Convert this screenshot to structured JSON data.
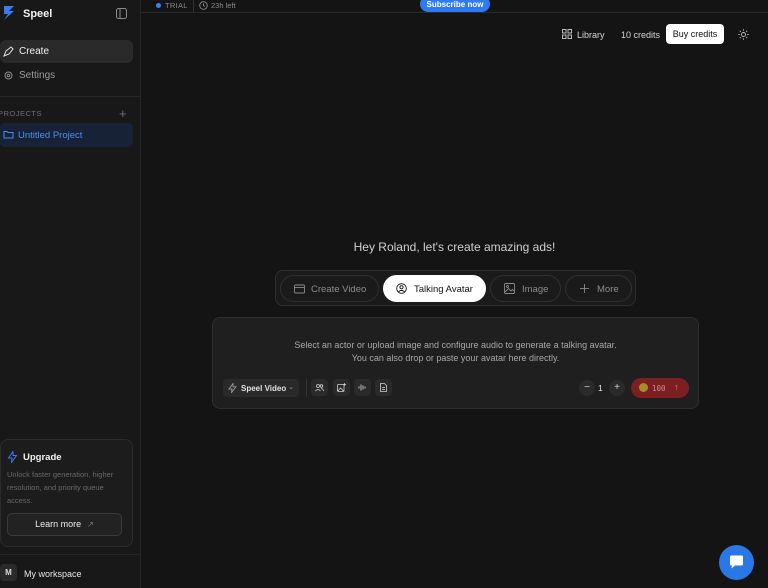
{
  "app": {
    "name": "Speel"
  },
  "sidebar": {
    "nav": [
      {
        "label": "Create",
        "icon": "pen-tool-icon",
        "active": true
      },
      {
        "label": "Settings",
        "icon": "gear-icon",
        "active": false
      }
    ],
    "projects_heading": "PROJECTS",
    "projects": [
      {
        "label": "Untitled Project",
        "icon": "folder-icon"
      }
    ],
    "upgrade": {
      "title": "Upgrade",
      "description": "Unlock faster generation, higher resolution, and priority queue access.",
      "button": "Learn more"
    },
    "workspace": {
      "avatar": "M",
      "label": "My workspace"
    }
  },
  "topbar": {
    "plan": "TRIAL",
    "time_left": "23h left",
    "subscribe": "Subscribe now"
  },
  "toolbar": {
    "library": "Library",
    "credits": "10 credits",
    "buy": "Buy credits"
  },
  "main": {
    "greeting": "Hey Roland, let's create amazing ads!",
    "modes": [
      {
        "label": "Create Video",
        "icon": "clapperboard-icon",
        "active": false
      },
      {
        "label": "Talking Avatar",
        "icon": "user-circle-icon",
        "active": true
      },
      {
        "label": "Image",
        "icon": "image-icon",
        "active": false
      },
      {
        "label": "More",
        "icon": "plus-icon",
        "active": false
      }
    ],
    "prompt": {
      "hint_line1": "Select an actor or upload image and configure audio to generate a talking avatar.",
      "hint_line2": "You can also drop or paste your avatar here directly.",
      "model": "Speel Video",
      "quantity": "1",
      "cost": "100"
    }
  },
  "colors": {
    "accent": "#2f7af0",
    "background": "#141414",
    "generate": "#7b1f22"
  }
}
